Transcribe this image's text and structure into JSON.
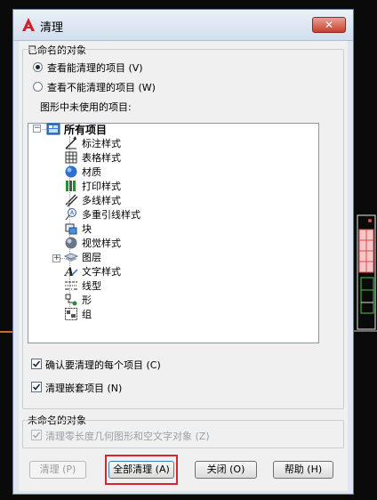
{
  "window": {
    "title": "清理",
    "close_label": "✕"
  },
  "named_objects": {
    "group_label": "已命名的对象",
    "radio_purgeable": "查看能清理的项目 (V)",
    "radio_not_purgeable": "查看不能清理的项目 (W)",
    "radio_selected": "purgeable",
    "tree_caption": "图形中未使用的项目:",
    "tree": {
      "root": "所有项目",
      "items": [
        {
          "label": "标注样式",
          "icon": "dimension-style-icon"
        },
        {
          "label": "表格样式",
          "icon": "table-style-icon"
        },
        {
          "label": "材质",
          "icon": "material-icon"
        },
        {
          "label": "打印样式",
          "icon": "plot-style-icon"
        },
        {
          "label": "多线样式",
          "icon": "multiline-style-icon"
        },
        {
          "label": "多重引线样式",
          "icon": "multileader-style-icon"
        },
        {
          "label": "块",
          "icon": "block-icon"
        },
        {
          "label": "视觉样式",
          "icon": "visual-style-icon"
        },
        {
          "label": "图层",
          "icon": "layer-icon",
          "expandable": true
        },
        {
          "label": "文字样式",
          "icon": "text-style-icon"
        },
        {
          "label": "线型",
          "icon": "linetype-icon"
        },
        {
          "label": "形",
          "icon": "shape-icon"
        },
        {
          "label": "组",
          "icon": "group-icon"
        }
      ]
    },
    "confirm_each": "确认要清理的每个项目 (C)",
    "confirm_each_checked": true,
    "purge_nested": "清理嵌套项目 (N)",
    "purge_nested_checked": true
  },
  "unnamed_objects": {
    "group_label": "未命名的对象",
    "purge_zero_length": "清理零长度几何图形和空文字对象 (Z)",
    "purge_zero_length_checked": true,
    "disabled": true
  },
  "buttons": {
    "purge": "清理 (P)",
    "purge_all": "全部清理 (A)",
    "close": "关闭 (O)",
    "help": "帮助 (H)"
  },
  "colors": {
    "highlight": "#d7262d",
    "titlebar": "#dde7f3",
    "close": "#c6402d"
  }
}
